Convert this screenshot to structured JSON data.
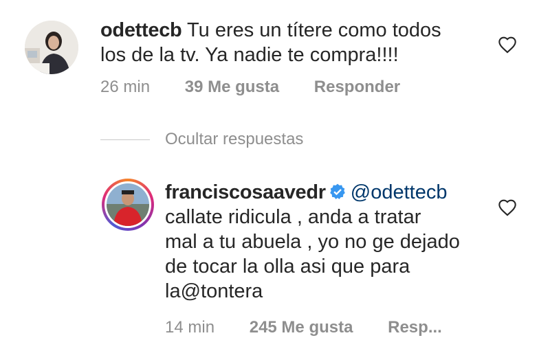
{
  "comments": [
    {
      "username": "odettecb",
      "text_line1": "Tu eres un títere como todos",
      "text_line2": "los de la tv. Ya nadie te compra!!!!",
      "time": "26 min",
      "likes": "39 Me gusta",
      "reply_label": "Responder",
      "liked": false
    },
    {
      "username": "franciscosaavedr",
      "verified": true,
      "mention": "@odettecb",
      "text_lines": [
        "callate ridicula , anda a tratar",
        "mal a tu abuela , yo no ge dejado",
        "de tocar la olla asi que para",
        "la@tontera"
      ],
      "time": "14 min",
      "likes": "245 Me gusta",
      "reply_label": "Resp...",
      "liked": false
    }
  ],
  "replies_toggle": {
    "label": "Ocultar respuestas"
  },
  "colors": {
    "meta": "#8e8e8e",
    "mention": "#00376b",
    "verified": "#3897f0"
  }
}
